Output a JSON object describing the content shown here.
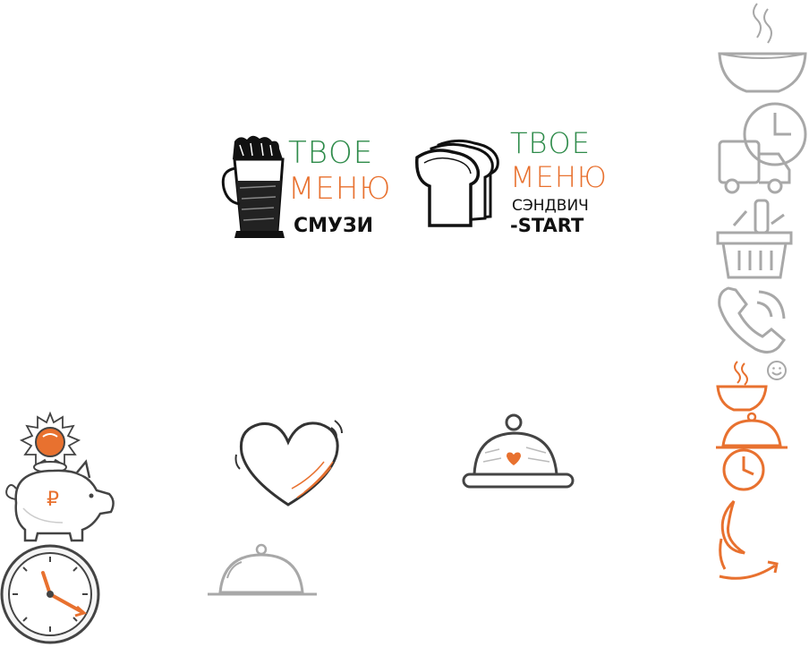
{
  "colors": {
    "green": "#2e8b4a",
    "orange": "#e8712f",
    "gray": "#a8a8a8",
    "ink": "#111111"
  },
  "logo_smoothie": {
    "word1": "ТВОЕ",
    "word2": "МЕНЮ",
    "tagline": "СМУЗИ",
    "icon": "smoothie-glass-icon"
  },
  "logo_sandwich": {
    "word1": "ТВОЕ",
    "word2": "МЕНЮ",
    "tagline_line1": "СЭНДВИЧ",
    "tagline_line2": "-START",
    "icon": "sandwich-bread-icon"
  },
  "icons": {
    "piggy_bank_symbol": "₽",
    "strip": [
      "soup-bowl-icon",
      "clock-icon",
      "delivery-truck-icon",
      "shopping-basket-icon",
      "phone-icon",
      "smile-icon",
      "hot-bowl-icon",
      "cloche-icon",
      "clock-icon",
      "arrow-icon"
    ]
  }
}
